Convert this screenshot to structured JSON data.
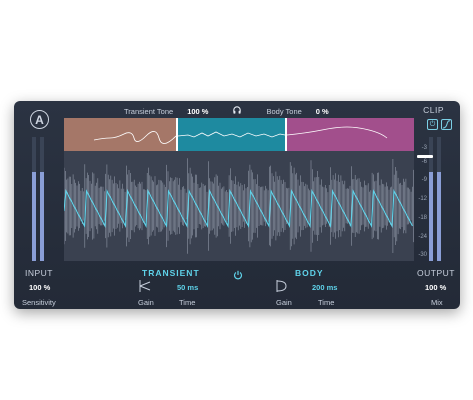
{
  "plugin": {
    "logo_letter": "A",
    "transient_tone_label": "Transient Tone",
    "transient_tone_value": "100 %",
    "body_tone_label": "Body Tone",
    "body_tone_value": "0 %",
    "clip_label": "CLIP",
    "input_label": "INPUT",
    "input_value": "100 %",
    "input_sub": "Sensitivity",
    "input_level": 0.72,
    "output_label": "OUTPUT",
    "output_value": "100 %",
    "output_sub": "Mix",
    "output_level": 0.72,
    "scale": [
      "-3",
      "-6",
      "-9",
      "-12",
      "-18",
      "-24",
      "-30"
    ],
    "transient": {
      "title": "TRANSIENT",
      "gain_label": "Gain",
      "time_label": "Time",
      "time_value": "50 ms"
    },
    "body": {
      "title": "BODY",
      "gain_label": "Gain",
      "time_label": "Time",
      "time_value": "200 ms"
    },
    "colors": {
      "band_low": "#a57768",
      "band_mid": "#1e8aa0",
      "band_high": "#a24f8c",
      "accent": "#5fd3ea"
    }
  }
}
